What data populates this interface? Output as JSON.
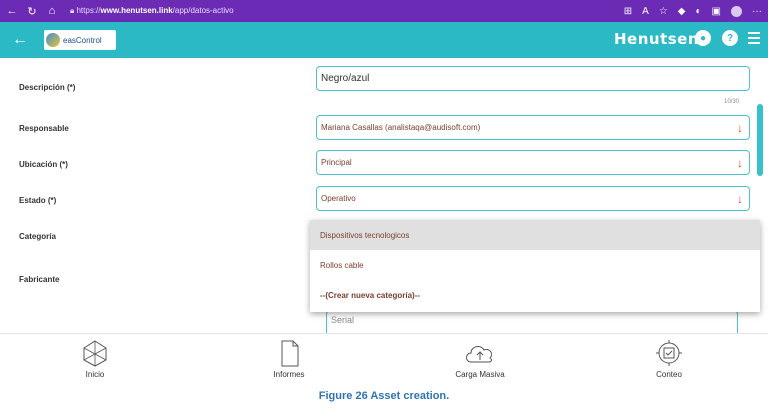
{
  "browser": {
    "url_prefix": "https://",
    "url_host": "www.henutsen.link",
    "url_path": "/app/datos-activo",
    "more": "···"
  },
  "header": {
    "logo_text": "easControl",
    "brand": "Henutsen",
    "accent_color": "#2bb9c6"
  },
  "form": {
    "descripcion_label": "Descripción (*)",
    "descripcion_value": "Negro/azul",
    "descripcion_counter": "10/30",
    "responsable_label": "Responsable",
    "responsable_value": "Mariana Casallas (analistaqa@audisoft.com)",
    "ubicacion_label": "Ubicación (*)",
    "ubicacion_value": "Principal",
    "estado_label": "Estado (*)",
    "estado_value": "Operativo",
    "categoria_label": "Categoría",
    "fabricante_label": "Fabricante",
    "serial_placeholder": "Serial"
  },
  "dropdown": {
    "items": [
      "Dispositivos tecnologicos",
      "Rollos cable",
      "--(Crear nueva categoría)--"
    ]
  },
  "bottom_nav": {
    "inicio": "Inicio",
    "informes": "Informes",
    "carga_masiva": "Carga Masiva",
    "conteo": "Conteo"
  },
  "caption": "Figure 26 Asset creation."
}
